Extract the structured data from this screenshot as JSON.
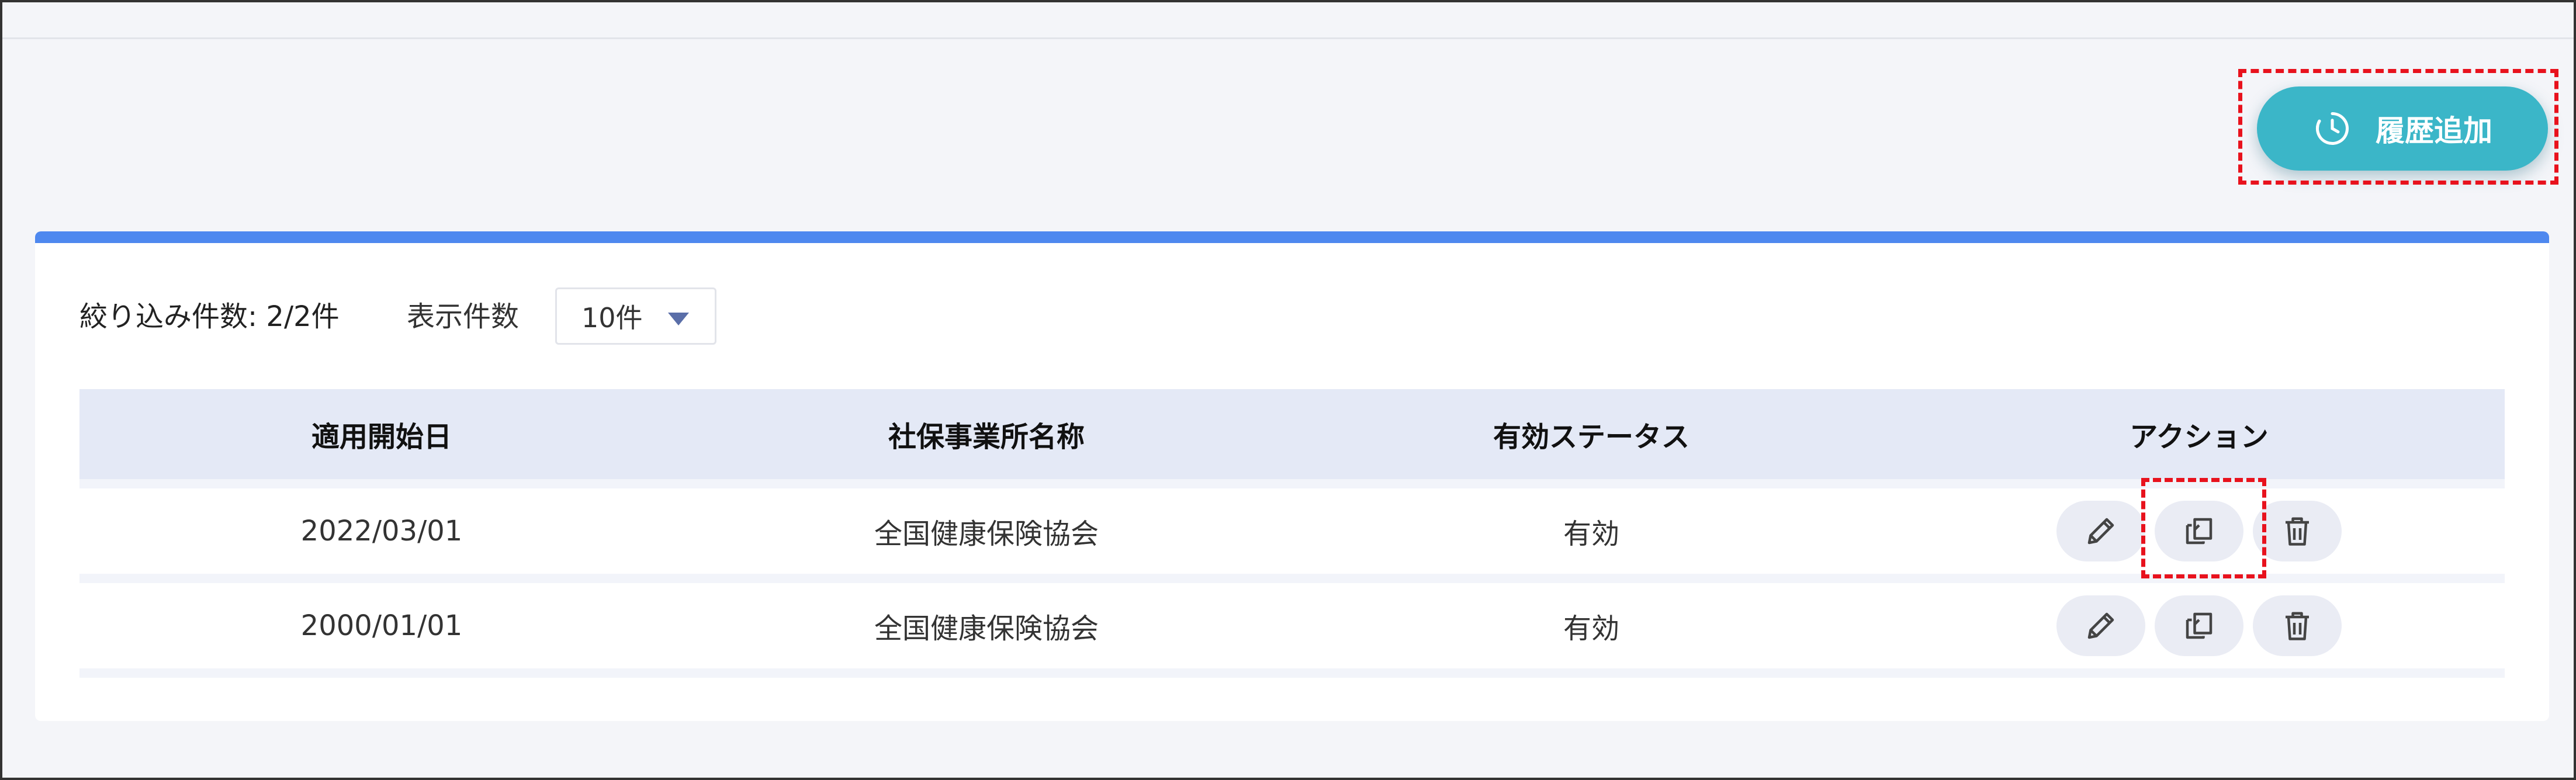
{
  "header": {
    "add_history_label": "履歴追加",
    "add_history_icon": "history-clock-icon"
  },
  "list": {
    "filter_count_text": "絞り込み件数: 2/2件",
    "per_page_label": "表示件数",
    "per_page_value": "10件"
  },
  "table": {
    "headers": [
      "適用開始日",
      "社保事業所名称",
      "有効ステータス",
      "アクション"
    ],
    "rows": [
      {
        "start_date": "2022/03/01",
        "office_name": "全国健康保険協会",
        "status": "有効"
      },
      {
        "start_date": "2000/01/01",
        "office_name": "全国健康保険協会",
        "status": "有効"
      }
    ],
    "action_icons": [
      "edit-pencil-icon",
      "copy-icon",
      "delete-trash-icon"
    ]
  },
  "colors": {
    "accent_teal": "#3bb6c8",
    "card_topbar_blue": "#4e88ef",
    "header_row_bg": "#e4e9f6",
    "annotation_red": "#e8121d"
  }
}
